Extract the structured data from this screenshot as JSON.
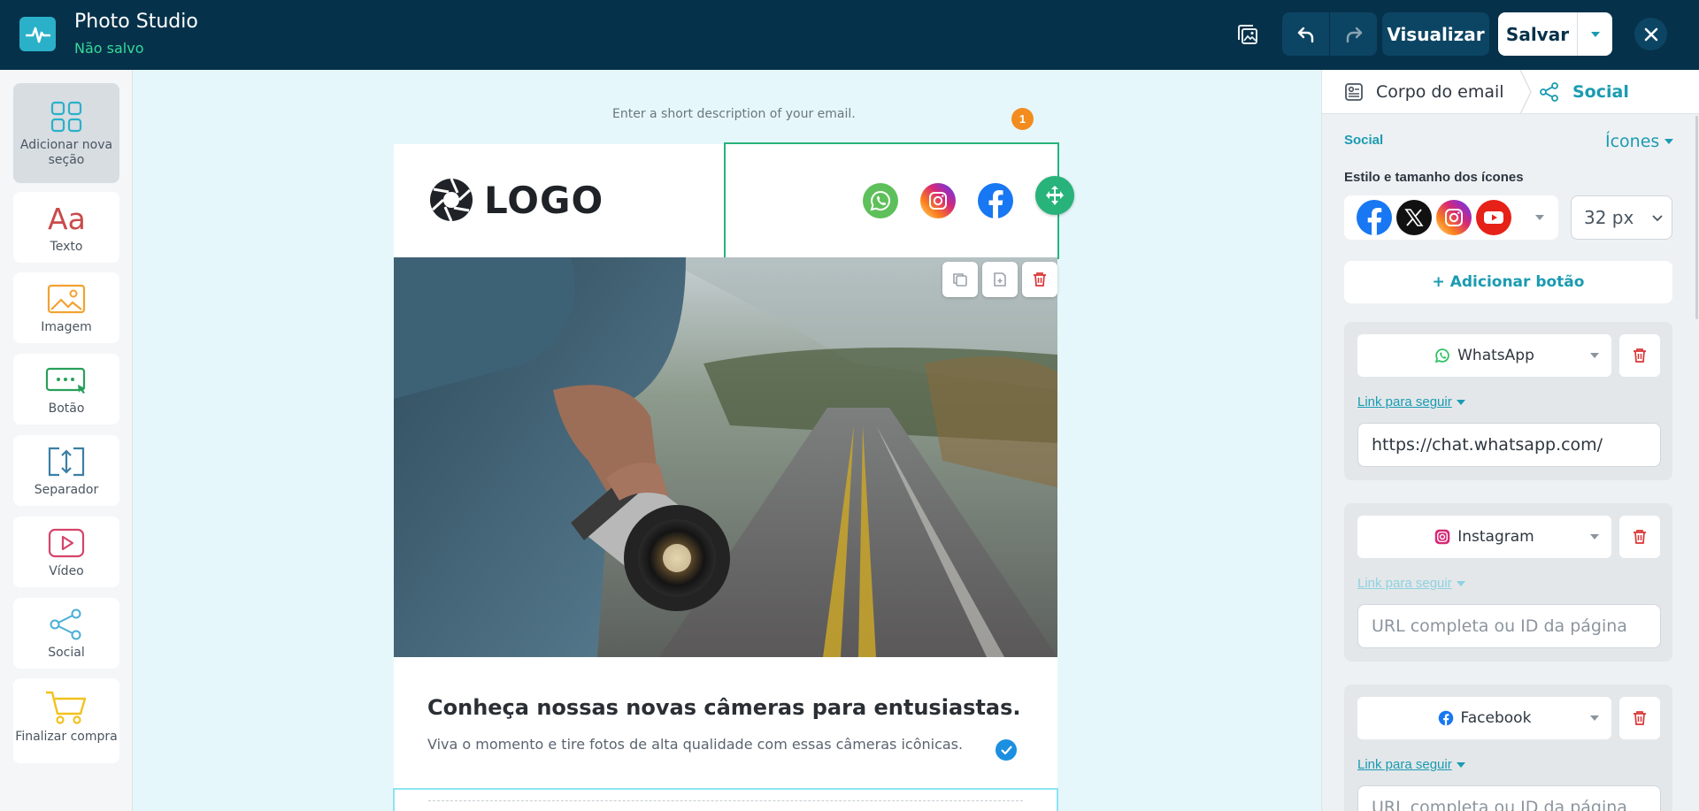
{
  "header": {
    "app_title": "Photo Studio",
    "status": "Não salvo",
    "preview_label": "Visualizar",
    "save_label": "Salvar"
  },
  "palette": {
    "items": [
      {
        "label": "Adicionar nova seção",
        "icon": "grid-icon"
      },
      {
        "label": "Texto",
        "icon": "text-icon"
      },
      {
        "label": "Imagem",
        "icon": "image-icon"
      },
      {
        "label": "Botão",
        "icon": "button-icon"
      },
      {
        "label": "Separador",
        "icon": "separator-icon"
      },
      {
        "label": "Vídeo",
        "icon": "video-icon"
      },
      {
        "label": "Social",
        "icon": "share-icon"
      },
      {
        "label": "Finalizar compra",
        "icon": "cart-icon"
      }
    ]
  },
  "canvas": {
    "preheader": "Enter a short description of your email.",
    "logo_text": "LOGO",
    "badge_count": "1",
    "headline": "Conheça nossas novas câmeras para entusiastas.",
    "subline": "Viva o momento e tire fotos de alta qualidade com essas câmeras icônicas."
  },
  "panel": {
    "breadcrumb": [
      "Corpo do email",
      "Social"
    ],
    "section_label": "Social",
    "icons_link": "Ícones",
    "style_label": "Estilo e tamanho dos ícones",
    "size_value": "32 px",
    "size_options": [
      "32 px"
    ],
    "add_button": "+ Adicionar botão",
    "networks": [
      {
        "name": "WhatsApp",
        "link_label": "Link para seguir",
        "url": "https://chat.whatsapp.com/",
        "placeholder": "URL completa ou ID da página"
      },
      {
        "name": "Instagram",
        "link_label": "Link para seguir",
        "url": "",
        "placeholder": "URL completa ou ID da página"
      },
      {
        "name": "Facebook",
        "link_label": "Link para seguir",
        "url": "",
        "placeholder": "URL completa ou ID da página"
      }
    ]
  },
  "colors": {
    "topbar": "#06314a",
    "accent": "#1a9bb1",
    "selection": "#27b37a",
    "danger": "#d93636"
  }
}
